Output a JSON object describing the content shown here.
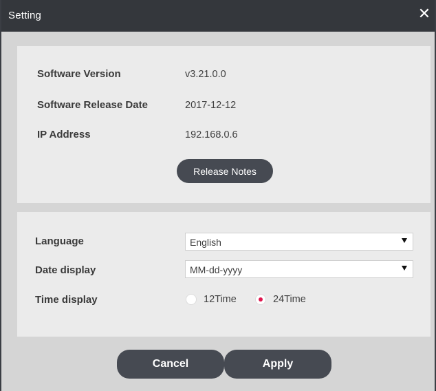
{
  "window": {
    "title": "Setting",
    "close_symbol": "✕"
  },
  "info": {
    "software_version_label": "Software Version",
    "software_version": "v3.21.0.0",
    "release_date_label": "Software Release Date",
    "release_date": "2017-12-12",
    "ip_label": "IP Address",
    "ip": "192.168.0.6",
    "release_notes_button": "Release Notes"
  },
  "settings": {
    "language_label": "Language",
    "language_value": "English",
    "date_display_label": "Date display",
    "date_display_value": "MM-dd-yyyy",
    "time_display_label": "Time display",
    "time_options": [
      {
        "label": "12Time",
        "selected": false
      },
      {
        "label": "24Time",
        "selected": true
      }
    ]
  },
  "footer": {
    "cancel": "Cancel",
    "apply": "Apply"
  },
  "colors": {
    "titlebar": "#34373c",
    "button": "#464a52",
    "radio_accent": "#e0174f"
  },
  "icons": {
    "close": "close-icon",
    "dropdown": "chevron-down-icon"
  }
}
